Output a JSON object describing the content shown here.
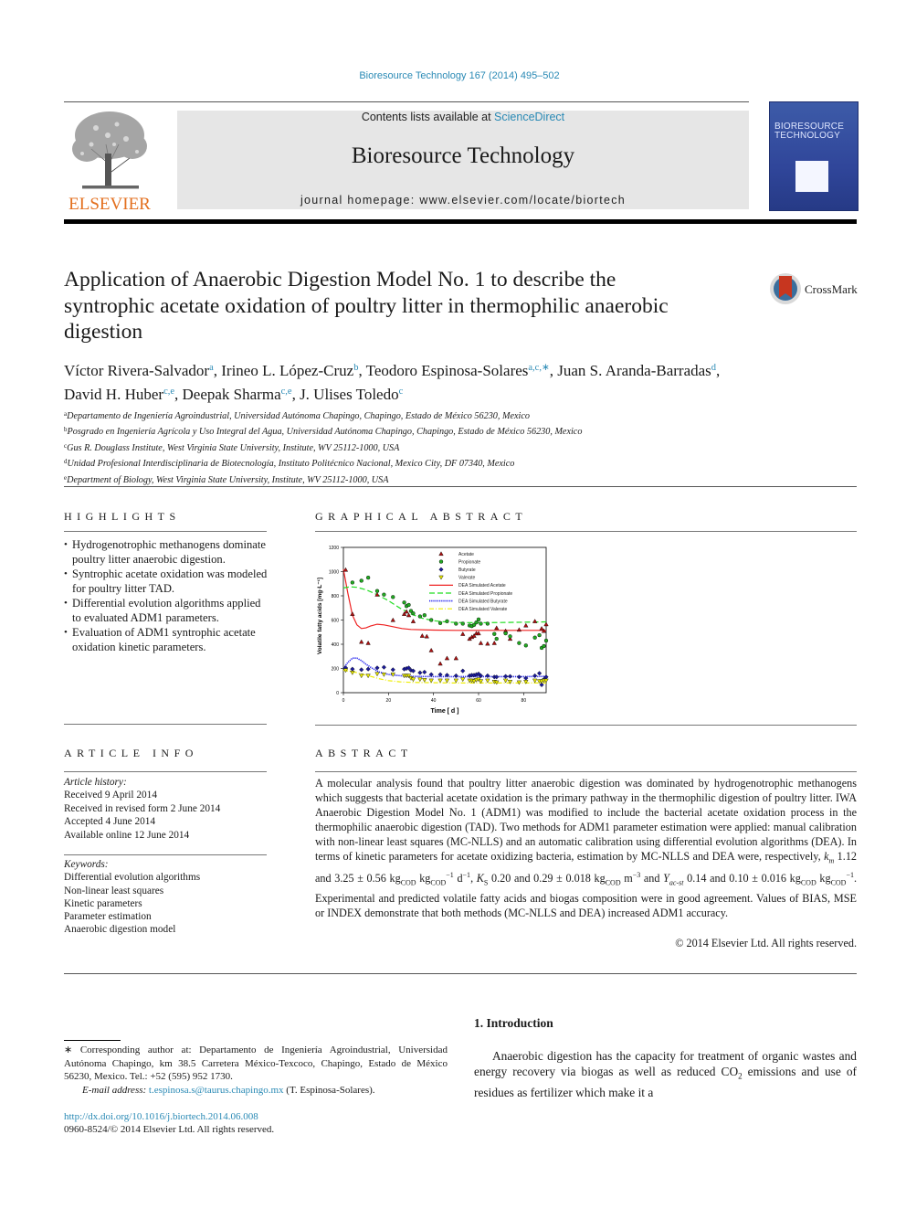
{
  "header": {
    "journal_ref": "Bioresource Technology 167 (2014) 495–502",
    "contents_prefix": "Contents lists available at ",
    "contents_link": "ScienceDirect",
    "journal_name": "Bioresource Technology",
    "homepage": "journal homepage: www.elsevier.com/locate/biortech",
    "publisher_logo_text": "ELSEVIER",
    "cover_title": "BIORESOURCE TECHNOLOGY"
  },
  "article": {
    "title": "Application of Anaerobic Digestion Model No. 1 to describe the syntrophic acetate oxidation of poultry litter in thermophilic anaerobic digestion",
    "crossmark": "CrossMark",
    "authors": [
      {
        "name": "Víctor Rivera-Salvador",
        "aff": "a"
      },
      {
        "name": "Irineo L. López-Cruz",
        "aff": "b"
      },
      {
        "name": "Teodoro Espinosa-Solares",
        "aff": "a,c,∗"
      },
      {
        "name": "Juan S. Aranda-Barradas",
        "aff": "d"
      },
      {
        "name": "David H. Huber",
        "aff": "c,e"
      },
      {
        "name": "Deepak Sharma",
        "aff": "c,e"
      },
      {
        "name": "J. Ulises Toledo",
        "aff": "c"
      }
    ],
    "affiliations": [
      {
        "key": "a",
        "text": "Departamento de Ingeniería Agroindustrial, Universidad Autónoma Chapingo, Chapingo, Estado de México 56230, Mexico"
      },
      {
        "key": "b",
        "text": "Posgrado en Ingeniería Agrícola y Uso Integral del Agua, Universidad Autónoma Chapingo, Chapingo, Estado de México 56230, Mexico"
      },
      {
        "key": "c",
        "text": "Gus R. Douglass Institute, West Virginia State University, Institute, WV 25112-1000, USA"
      },
      {
        "key": "d",
        "text": "Unidad Profesional Interdisciplinaria de Biotecnología, Instituto Politécnico Nacional, Mexico City, DF 07340, Mexico"
      },
      {
        "key": "e",
        "text": "Department of Biology, West Virginia State University, Institute, WV 25112-1000, USA"
      }
    ]
  },
  "highlights": {
    "heading": "HIGHLIGHTS",
    "items": [
      "Hydrogenotrophic methanogens dominate poultry litter anaerobic digestion.",
      "Syntrophic acetate oxidation was modeled for poultry litter TAD.",
      "Differential evolution algorithms applied to evaluated ADM1 parameters.",
      "Evaluation of ADM1 syntrophic acetate oxidation kinetic parameters."
    ]
  },
  "graphical_abstract": {
    "heading": "GRAPHICAL ABSTRACT"
  },
  "chart_data": {
    "type": "scatter",
    "title": "",
    "xlabel": "Time [ d ]",
    "ylabel": "Volatile fatty acids [mg·L⁻¹]",
    "xlim": [
      0,
      90
    ],
    "ylim": [
      0,
      1200
    ],
    "xticks": [
      0,
      20,
      40,
      60,
      80
    ],
    "yticks": [
      0,
      200,
      400,
      600,
      800,
      1000,
      1200
    ],
    "legend_position": "top-right",
    "series": [
      {
        "name": "Acetate",
        "kind": "points",
        "marker": "triangle-up",
        "color": "#b01010",
        "x": [
          1,
          4,
          8,
          11,
          15,
          22,
          27,
          28,
          29,
          31,
          35,
          37,
          39,
          43,
          46,
          50,
          53,
          56,
          57,
          58,
          59,
          60,
          61,
          64,
          67,
          68,
          72,
          74,
          78,
          81,
          85,
          88,
          89,
          90
        ],
        "y": [
          1015,
          650,
          420,
          410,
          810,
          600,
          650,
          670,
          640,
          590,
          470,
          465,
          350,
          240,
          285,
          285,
          485,
          445,
          460,
          470,
          490,
          490,
          410,
          405,
          410,
          535,
          510,
          445,
          520,
          555,
          590,
          530,
          510,
          565
        ]
      },
      {
        "name": "Propionate",
        "kind": "points",
        "marker": "circle",
        "color": "#22aa22",
        "x": [
          4,
          8,
          11,
          15,
          18,
          22,
          27,
          28,
          29,
          30,
          31,
          34,
          36,
          39,
          43,
          46,
          50,
          53,
          56,
          57,
          58,
          59,
          60,
          61,
          64,
          67,
          68,
          72,
          74,
          78,
          81,
          85,
          87,
          88,
          89,
          90
        ],
        "y": [
          910,
          925,
          950,
          840,
          810,
          790,
          745,
          715,
          725,
          675,
          655,
          630,
          640,
          600,
          575,
          590,
          570,
          570,
          555,
          550,
          560,
          580,
          605,
          570,
          570,
          485,
          445,
          490,
          465,
          410,
          390,
          455,
          475,
          370,
          385,
          430
        ]
      },
      {
        "name": "Butyrate",
        "kind": "points",
        "marker": "diamond",
        "color": "#1a1a9a",
        "x": [
          1,
          4,
          8,
          11,
          15,
          18,
          22,
          27,
          28,
          29,
          30,
          31,
          34,
          36,
          39,
          43,
          46,
          50,
          53,
          56,
          57,
          58,
          59,
          60,
          61,
          64,
          67,
          68,
          72,
          74,
          78,
          81,
          85,
          87,
          88,
          89,
          90
        ],
        "y": [
          205,
          195,
          190,
          195,
          205,
          210,
          190,
          195,
          200,
          205,
          185,
          180,
          165,
          170,
          150,
          150,
          145,
          140,
          180,
          140,
          145,
          145,
          150,
          155,
          140,
          140,
          130,
          130,
          135,
          135,
          130,
          120,
          140,
          160,
          65,
          110,
          130
        ]
      },
      {
        "name": "Valerate",
        "kind": "points",
        "marker": "triangle-down",
        "color": "#e8e800",
        "x": [
          1,
          4,
          8,
          11,
          15,
          18,
          22,
          27,
          28,
          29,
          30,
          31,
          34,
          36,
          39,
          43,
          46,
          50,
          53,
          56,
          57,
          58,
          59,
          60,
          61,
          64,
          67,
          68,
          72,
          74,
          78,
          81,
          85,
          87,
          88,
          89,
          90
        ],
        "y": [
          185,
          165,
          140,
          140,
          155,
          150,
          150,
          140,
          140,
          140,
          120,
          110,
          110,
          105,
          100,
          100,
          100,
          100,
          110,
          100,
          100,
          95,
          105,
          110,
          95,
          100,
          90,
          85,
          100,
          90,
          85,
          90,
          100,
          95,
          95,
          100,
          100
        ]
      },
      {
        "name": "DEA Simulated Acetate",
        "kind": "line",
        "style": "solid",
        "color": "#ee2222",
        "x": [
          0,
          2,
          4,
          6,
          8,
          10,
          12,
          15,
          18,
          22,
          26,
          30,
          40,
          50,
          60,
          70,
          80,
          90
        ],
        "y": [
          1020,
          820,
          640,
          560,
          530,
          535,
          550,
          565,
          560,
          545,
          530,
          522,
          517,
          515,
          515,
          515,
          515,
          515
        ]
      },
      {
        "name": "DEA Simulated Propionate",
        "kind": "line",
        "style": "dashed",
        "color": "#22dd22",
        "x": [
          0,
          3,
          6,
          10,
          15,
          20,
          25,
          30,
          35,
          40,
          45,
          50,
          60,
          70,
          80,
          90
        ],
        "y": [
          865,
          875,
          870,
          850,
          810,
          760,
          700,
          650,
          615,
          595,
          585,
          580,
          578,
          580,
          582,
          585
        ]
      },
      {
        "name": "DEA Simulated Butyrate",
        "kind": "line",
        "style": "dotted",
        "color": "#2222ee",
        "x": [
          0,
          2,
          4,
          6,
          8,
          10,
          13,
          16,
          20,
          25,
          30,
          40,
          50,
          60,
          70,
          80,
          90
        ],
        "y": [
          200,
          250,
          285,
          285,
          265,
          235,
          200,
          170,
          150,
          140,
          135,
          133,
          132,
          133,
          133,
          133,
          134
        ]
      },
      {
        "name": "DEA Simulated Valerate",
        "kind": "line",
        "style": "dashdot",
        "color": "#eeee00",
        "x": [
          0,
          4,
          8,
          12,
          16,
          20,
          25,
          30,
          40,
          50,
          60,
          70,
          80,
          90
        ],
        "y": [
          185,
          175,
          155,
          135,
          115,
          100,
          90,
          85,
          82,
          80,
          80,
          80,
          80,
          80
        ]
      }
    ]
  },
  "article_info": {
    "heading": "ARTICLE INFO",
    "history_label": "Article history:",
    "history": [
      "Received 9 April 2014",
      "Received in revised form 2 June 2014",
      "Accepted 4 June 2014",
      "Available online 12 June 2014"
    ],
    "keywords_label": "Keywords:",
    "keywords": [
      "Differential evolution algorithms",
      "Non-linear least squares",
      "Kinetic parameters",
      "Parameter estimation",
      "Anaerobic digestion model"
    ]
  },
  "abstract": {
    "heading": "ABSTRACT",
    "p1": "A molecular analysis found that poultry litter anaerobic digestion was dominated by hydrogenotrophic methanogens which suggests that bacterial acetate oxidation is the primary pathway in the thermophilic digestion of poultry litter. IWA Anaerobic Digestion Model No. 1 (ADM1) was modified to include the bacterial acetate oxidation process in the thermophilic anaerobic digestion (TAD). Two methods for ADM1 parameter estimation were applied: manual calibration with non-linear least squares (MC-NLLS) and an automatic calibration using differential evolution algorithms (DEA). In terms of kinetic parameters for acetate oxidizing bacteria, estimation by MC-NLLS and DEA were, respectively, ",
    "km_sym": "k",
    "km_sub": "m",
    "km_vals": " 1.12 and 3.25 ± 0.56 kg",
    "cod": "COD",
    "kg": " kg",
    "inv": "−1",
    "d_unit": " d",
    "ks_sep": ", ",
    "ks_sym": "K",
    "ks_sub": "S",
    "ks_vals": " 0.20 and 0.29 ± 0.018 kg",
    "m_unit": " m",
    "m3": "−3",
    "and": " and ",
    "y_sym": "Y",
    "y_sub": "ac-st",
    "y_vals": " 0.14 and 0.10 ± 0.016 kg",
    "p2": ". Experimental and predicted volatile fatty acids and biogas composition were in good agreement. Values of BIAS, MSE or INDEX demonstrate that both methods (MC-NLLS and DEA) increased ADM1 accuracy.",
    "copyright": "© 2014 Elsevier Ltd. All rights reserved."
  },
  "footnote": {
    "corresponding": "∗ Corresponding author at: Departamento de Ingeniería Agroindustrial, Universidad Autónoma Chapingo, km 38.5 Carretera México-Texcoco, Chapingo, Estado de México 56230, Mexico. Tel.: +52 (595) 952 1730.",
    "email_label": "E-mail address: ",
    "email": "t.espinosa.s@taurus.chapingo.mx",
    "email_owner": " (T. Espinosa-Solares).",
    "doi": "http://dx.doi.org/10.1016/j.biortech.2014.06.008",
    "issn": "0960-8524/© 2014 Elsevier Ltd. All rights reserved."
  },
  "introduction": {
    "heading": "1. Introduction",
    "text_a": "Anaerobic digestion has the capacity for treatment of organic wastes and energy recovery via biogas as well as reduced CO",
    "co2_sub": "2",
    "text_b": " emissions and use of residues as fertilizer which make it a"
  }
}
